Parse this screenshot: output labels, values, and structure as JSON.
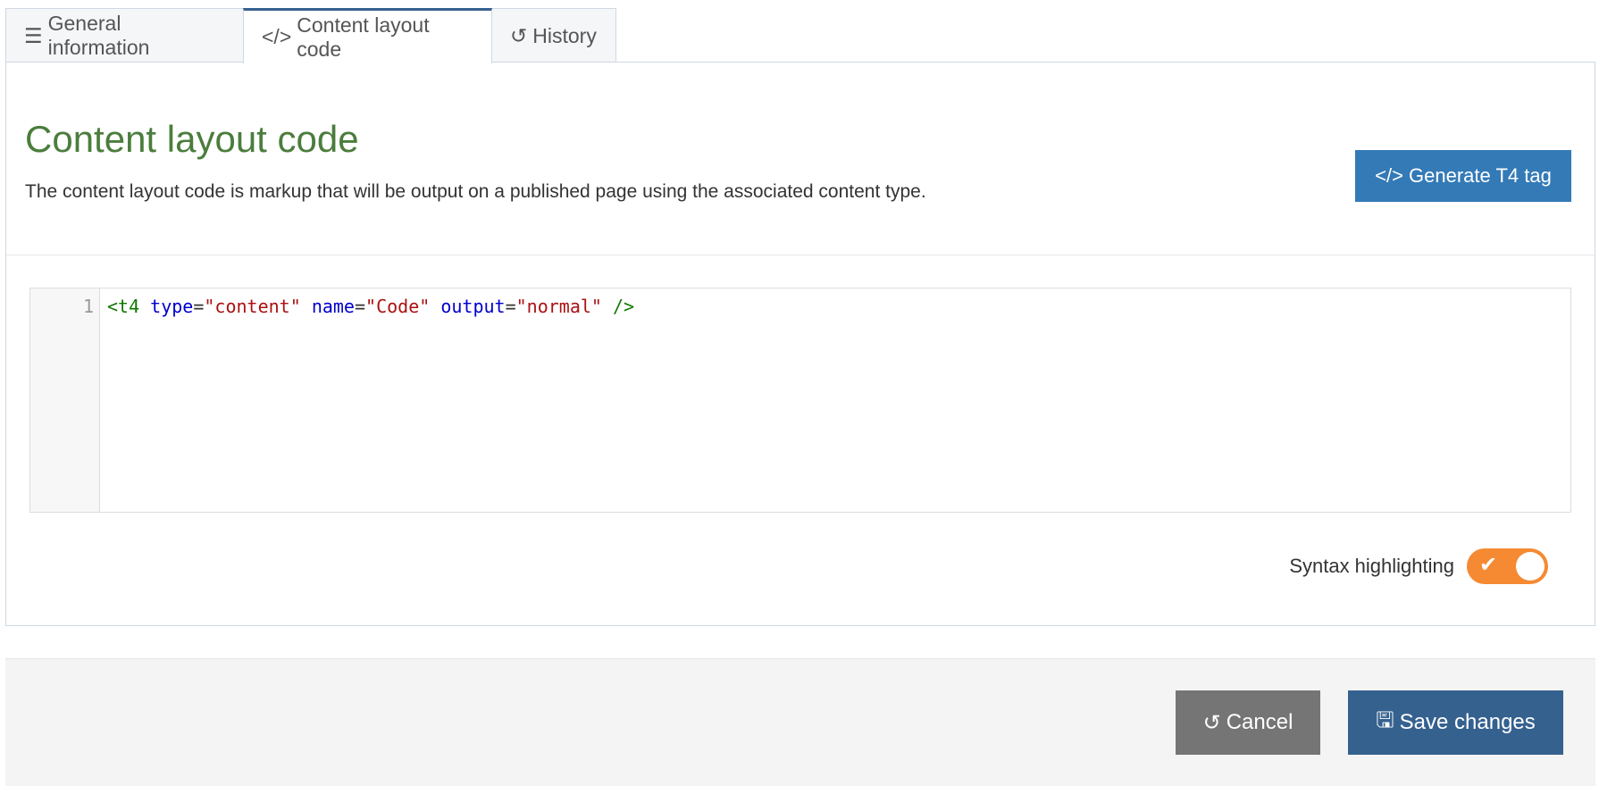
{
  "tabs": [
    {
      "label": "General information",
      "icon": "sliders-icon"
    },
    {
      "label": "Content layout code",
      "icon": "code-icon"
    },
    {
      "label": "History",
      "icon": "history-icon"
    }
  ],
  "active_tab": "Content layout code",
  "heading": "Content layout code",
  "description": "The content layout code is markup that will be output on a published page using the associated content type.",
  "generate_button": "Generate T4 tag",
  "editor": {
    "line_number": "1",
    "tokens": {
      "open": "<t4",
      "a1": "type",
      "v1": "\"content\"",
      "a2": "name",
      "v2": "\"Code\"",
      "a3": "output",
      "v3": "\"normal\"",
      "close": "/>",
      "eq": "="
    }
  },
  "syntax_label": "Syntax highlighting",
  "syntax_enabled": true,
  "colors": {
    "accent": "#f58a33",
    "heading": "#4b7d3c",
    "primary": "#337ab7",
    "save": "#35618f"
  },
  "footer": {
    "cancel": "Cancel",
    "save": "Save changes"
  }
}
